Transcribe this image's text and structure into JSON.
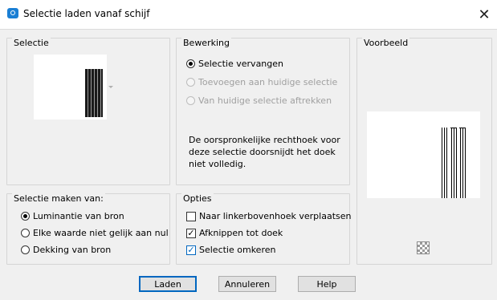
{
  "window": {
    "title": "Selectie laden vanaf schijf",
    "close_glyph": "✕"
  },
  "groups": {
    "selectie": {
      "label": "Selectie"
    },
    "bewerking": {
      "label": "Bewerking",
      "options": [
        {
          "label": "Selectie vervangen",
          "checked": true,
          "enabled": true
        },
        {
          "label": "Toevoegen aan huidige selectie",
          "checked": false,
          "enabled": false
        },
        {
          "label": "Van huidige selectie aftrekken",
          "checked": false,
          "enabled": false
        }
      ],
      "note": "De oorspronkelijke rechthoek voor deze selectie doorsnijdt het doek niet volledig."
    },
    "voorbeeld": {
      "label": "Voorbeeld"
    },
    "selectie_maken_van": {
      "label": "Selectie maken van:",
      "options": [
        {
          "label": "Luminantie van bron",
          "checked": true
        },
        {
          "label": "Elke waarde niet gelijk aan nul",
          "checked": false
        },
        {
          "label": "Dekking van bron",
          "checked": false
        }
      ]
    },
    "opties": {
      "label": "Opties",
      "checks": [
        {
          "label": "Naar linkerbovenhoek verplaatsen",
          "checked": false
        },
        {
          "label": "Afknippen tot doek",
          "checked": true
        },
        {
          "label": "Selectie omkeren",
          "checked": true
        }
      ]
    }
  },
  "buttons": {
    "laden": "Laden",
    "annuleren": "Annuleren",
    "help": "Help"
  },
  "icons": {
    "title": "camera-icon",
    "close": "close-icon",
    "dropdown": "chevron-down-icon",
    "transparency": "checkerboard-icon"
  },
  "colors": {
    "accent": "#0067c0",
    "title_icon": "#1a7fd4",
    "dialog_bg": "#f0f0f0"
  }
}
